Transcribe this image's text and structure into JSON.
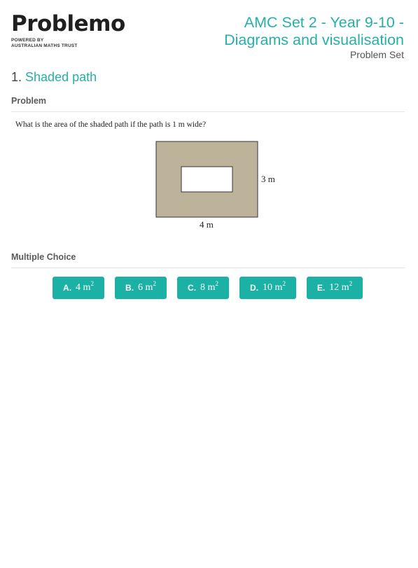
{
  "logo": {
    "word": "Problemo",
    "tagline_1": "POWERED BY",
    "tagline_2": "AUSTRALIAN MATHS TRUST"
  },
  "header": {
    "title_line_1": "AMC Set 2 - Year 9-10 -",
    "title_line_2": "Diagrams and visualisation",
    "subtitle": "Problem Set"
  },
  "question": {
    "number": "1.",
    "title": "Shaded path",
    "problem_label": "Problem",
    "text": "What is the area of the shaded path if the path is 1 m wide?",
    "diagram": {
      "height_label": "3 m",
      "width_label": "4 m",
      "fill_color": "#bdb39a"
    },
    "choices_label": "Multiple Choice",
    "choices": [
      {
        "letter": "A.",
        "value": "4 m",
        "exp": "2"
      },
      {
        "letter": "B.",
        "value": "6 m",
        "exp": "2"
      },
      {
        "letter": "C.",
        "value": "8 m",
        "exp": "2"
      },
      {
        "letter": "D.",
        "value": "10 m",
        "exp": "2"
      },
      {
        "letter": "E.",
        "value": "12 m",
        "exp": "2"
      }
    ],
    "accent_color": "#1bb1a5"
  }
}
